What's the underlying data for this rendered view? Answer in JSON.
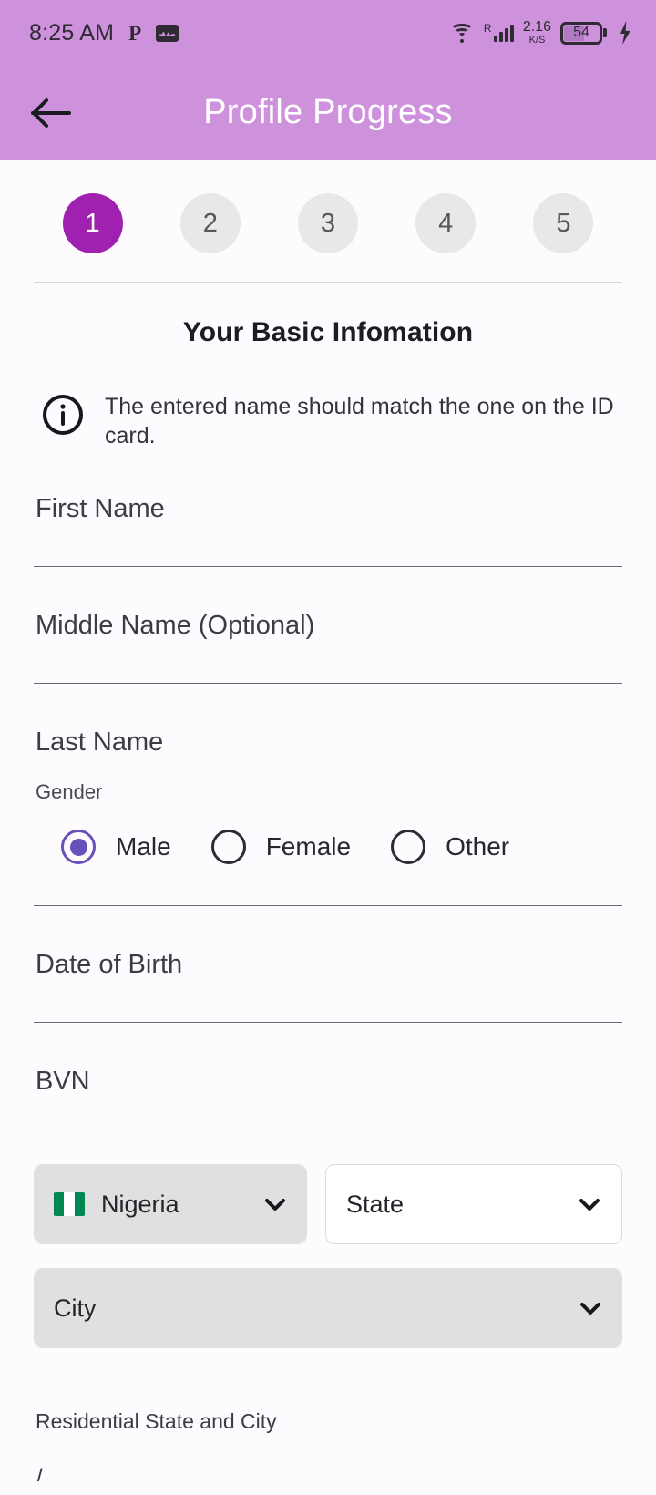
{
  "status_bar": {
    "time": "8:25 AM",
    "p_icon": "p-icon",
    "activity_icon": "activity-graph-icon",
    "wifi_icon": "wifi-icon",
    "roaming_label": "R",
    "signal_icon": "signal-bars-icon",
    "net_speed_value": "2.16",
    "net_speed_unit": "K/S",
    "battery_percent": "54",
    "charging_icon": "charging-bolt-icon"
  },
  "appbar": {
    "back_icon": "back-arrow-icon",
    "title": "Profile Progress",
    "background": "#CE92DD"
  },
  "stepper": {
    "active_index": 0,
    "active_color": "#A020B0",
    "inactive_color": "#E8E8E8",
    "steps": [
      {
        "label": "1"
      },
      {
        "label": "2"
      },
      {
        "label": "3"
      },
      {
        "label": "4"
      },
      {
        "label": "5"
      }
    ]
  },
  "form": {
    "section_title": "Your Basic Infomation",
    "info_icon": "info-circle-icon",
    "info_text": "The entered name should match the one on the ID card.",
    "fields": [
      {
        "label": "First Name",
        "value": ""
      },
      {
        "label": "Middle Name (Optional)",
        "value": ""
      },
      {
        "label": "Last Name",
        "value": ""
      }
    ],
    "gender": {
      "label": "Gender",
      "selected": "Male",
      "accent_color": "#6651BD",
      "options": [
        {
          "label": "Male",
          "checked": true
        },
        {
          "label": "Female",
          "checked": false
        },
        {
          "label": "Other",
          "checked": false
        }
      ]
    },
    "dob": {
      "label": "Date of Birth",
      "value": ""
    },
    "bvn": {
      "label": "BVN",
      "value": ""
    },
    "location": {
      "country": {
        "label": "Nigeria",
        "flag_icon": "nigeria-flag-icon",
        "chevron_icon": "chevron-down-icon"
      },
      "state": {
        "label": "State",
        "chevron_icon": "chevron-down-icon"
      },
      "city": {
        "label": "City",
        "chevron_icon": "chevron-down-icon"
      }
    },
    "residential_label": "Residential State and City",
    "cut_off_text": "/"
  }
}
